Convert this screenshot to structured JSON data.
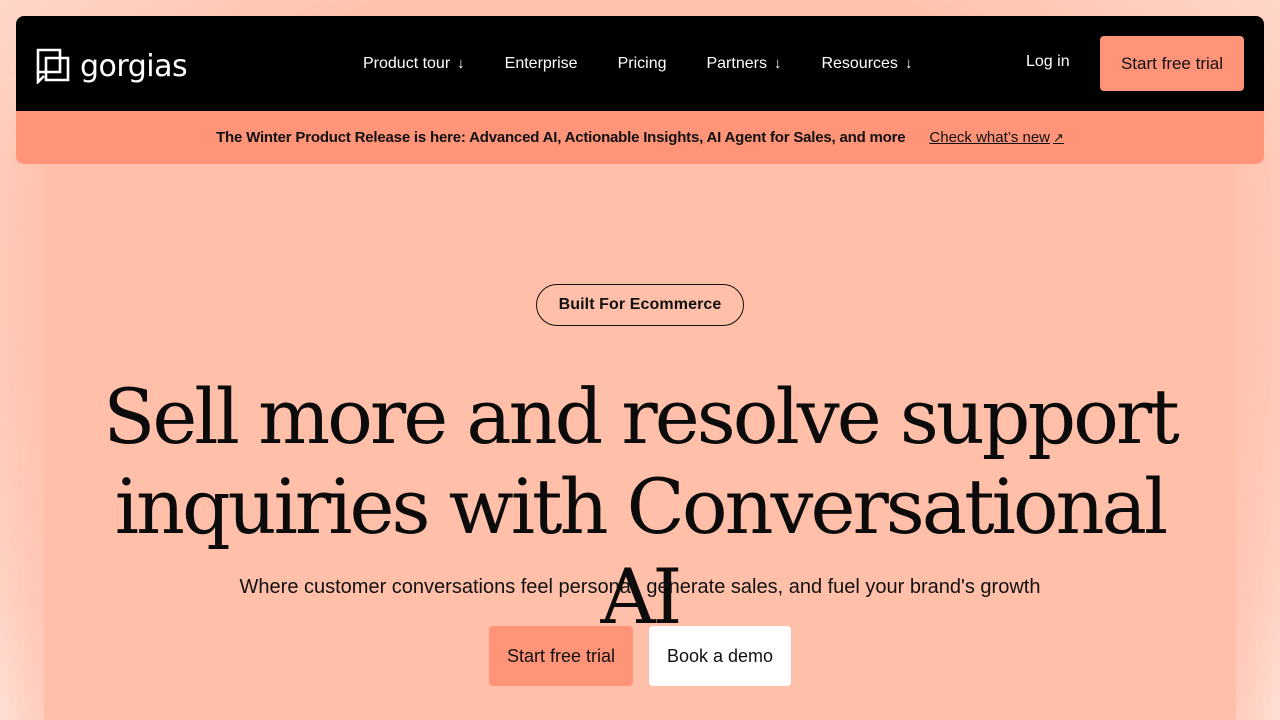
{
  "brand": {
    "name": "gorgias"
  },
  "nav": {
    "items": [
      {
        "label": "Product tour",
        "has_dropdown": true
      },
      {
        "label": "Enterprise",
        "has_dropdown": false
      },
      {
        "label": "Pricing",
        "has_dropdown": false
      },
      {
        "label": "Partners",
        "has_dropdown": true
      },
      {
        "label": "Resources",
        "has_dropdown": true
      }
    ],
    "login_label": "Log in",
    "trial_label": "Start free trial"
  },
  "banner": {
    "text": "The Winter Product Release is here: Advanced AI, Actionable Insights, AI Agent for Sales, and more",
    "link_label": "Check what’s new"
  },
  "hero": {
    "pill_label": "Built For Ecommerce",
    "headline_line1": "Sell more and resolve support",
    "headline_line2": "inquiries with Conversational AI",
    "subheadline": "Where customer conversations feel personal, generate sales, and fuel your brand's growth",
    "primary_cta": "Start free trial",
    "secondary_cta": "Book a demo"
  },
  "colors": {
    "accent": "#ff9479",
    "nav_bg": "#000000",
    "hero_bg": "#ffbfa9"
  }
}
